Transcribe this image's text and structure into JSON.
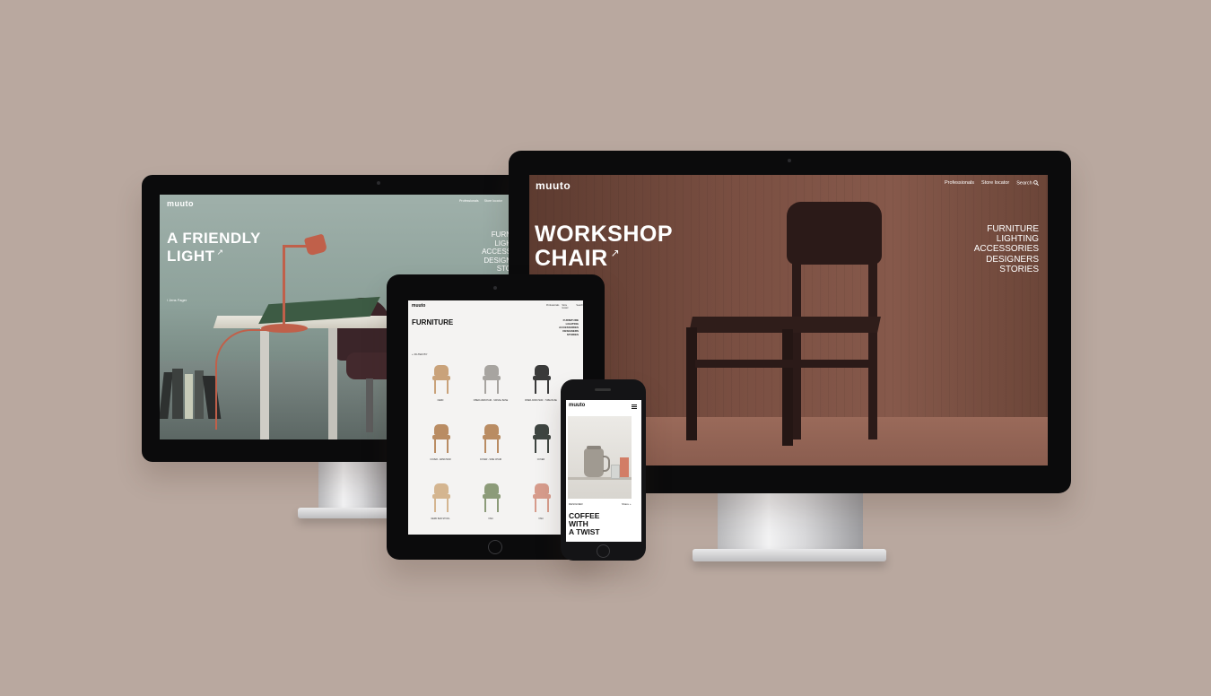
{
  "colors": {
    "background": "#b9a89f",
    "bezel": "#0b0b0c",
    "left_screen_wall": "#8da19a",
    "right_screen_wall": "#7a4f42",
    "lamp": "#c0604a",
    "tablet_screen": "#f4f3f2"
  },
  "left_monitor": {
    "logo": "muuto",
    "nav": [
      "Professionals",
      "Store locator"
    ],
    "headline_line1": "A FRIENDLY",
    "headline_line2": "LIGHT",
    "arrow": "↗",
    "designer": "/  Jens Fager",
    "menu": [
      "FURN",
      "LIGH",
      "ACCESS",
      "DESIGN",
      "STO"
    ]
  },
  "right_monitor": {
    "logo": "muuto",
    "nav": [
      "Professionals",
      "Store locator",
      "Search"
    ],
    "search_icon": "search-icon",
    "headline_line1": "WORKSHOP",
    "headline_line2": "CHAIR",
    "arrow": "↗",
    "menu": [
      "FURNITURE",
      "LIGHTING",
      "ACCESSORIES",
      "DESIGNERS",
      "STORIES"
    ]
  },
  "tablet": {
    "logo": "muuto",
    "nav": [
      "Professionals",
      "Store locator",
      "Search"
    ],
    "title": "FURNITURE",
    "menu": [
      "FURNITURE",
      "LIGHTING",
      "ACCESSORIES",
      "DESIGNERS",
      "STORIES"
    ],
    "filter": "+ FILTER BY",
    "products": [
      {
        "name": "NERD",
        "color": "#c9a27a"
      },
      {
        "name": "FIBER ARMCHAIR - SWIVEL BASE",
        "color": "#a7a4a0"
      },
      {
        "name": "FIBER ARMCHAIR - TUBE BASE",
        "color": "#3a3a3a"
      },
      {
        "name": "COVER - ARMCHAIR",
        "color": "#b98c63"
      },
      {
        "name": "COVER - SIDE CHAIR",
        "color": "#b98c63"
      },
      {
        "name": "COVER",
        "color": "#3e4541"
      },
      {
        "name": "NERD BAR STOOL",
        "color": "#d4b590"
      },
      {
        "name": "VISU",
        "color": "#8c9b79"
      },
      {
        "name": "VISU",
        "color": "#d79c8c"
      }
    ]
  },
  "phone": {
    "logo": "muuto",
    "menu_icon": "hamburger-icon",
    "category": "DESIGNER",
    "share": "Share +",
    "headline": [
      "COFFEE",
      "WITH",
      "A TWIST"
    ]
  }
}
